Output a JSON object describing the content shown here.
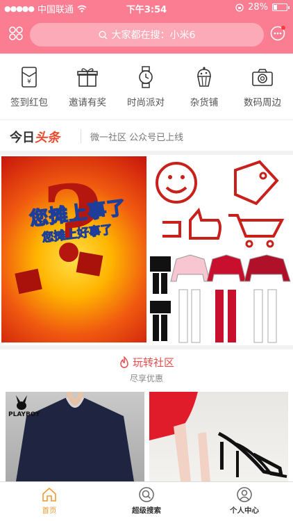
{
  "status_bar": {
    "carrier": "中国联通",
    "time": "下午3:54",
    "battery": "28%"
  },
  "search": {
    "placeholder": "大家都在搜：小米6"
  },
  "menu": [
    {
      "label": "签到红包",
      "icon": "red-envelope-icon"
    },
    {
      "label": "邀请有奖",
      "icon": "gift-icon"
    },
    {
      "label": "时尚派对",
      "icon": "watch-icon"
    },
    {
      "label": "杂货铺",
      "icon": "cupcake-icon"
    },
    {
      "label": "数码周边",
      "icon": "camera-icon"
    }
  ],
  "headline": {
    "logo_part1": "今日",
    "logo_part2": "头条",
    "text": "微一社区 公众号已上线"
  },
  "banner": {
    "slogan_main": "您摊上事了",
    "slogan_sub": "您摊上好事了"
  },
  "community": {
    "title": "玩转社区",
    "subtitle": "尽享优惠",
    "brand": "PLAYBOY"
  },
  "tabbar": [
    {
      "label": "首页",
      "icon": "home-icon",
      "active": true
    },
    {
      "label": "超级搜索",
      "icon": "search-icon",
      "active": false
    },
    {
      "label": "个人中心",
      "icon": "user-icon",
      "active": false
    }
  ],
  "colors": {
    "primary": "#fb7d92",
    "active_tab": "#f29a2e",
    "community_title": "#ea4b4b"
  }
}
